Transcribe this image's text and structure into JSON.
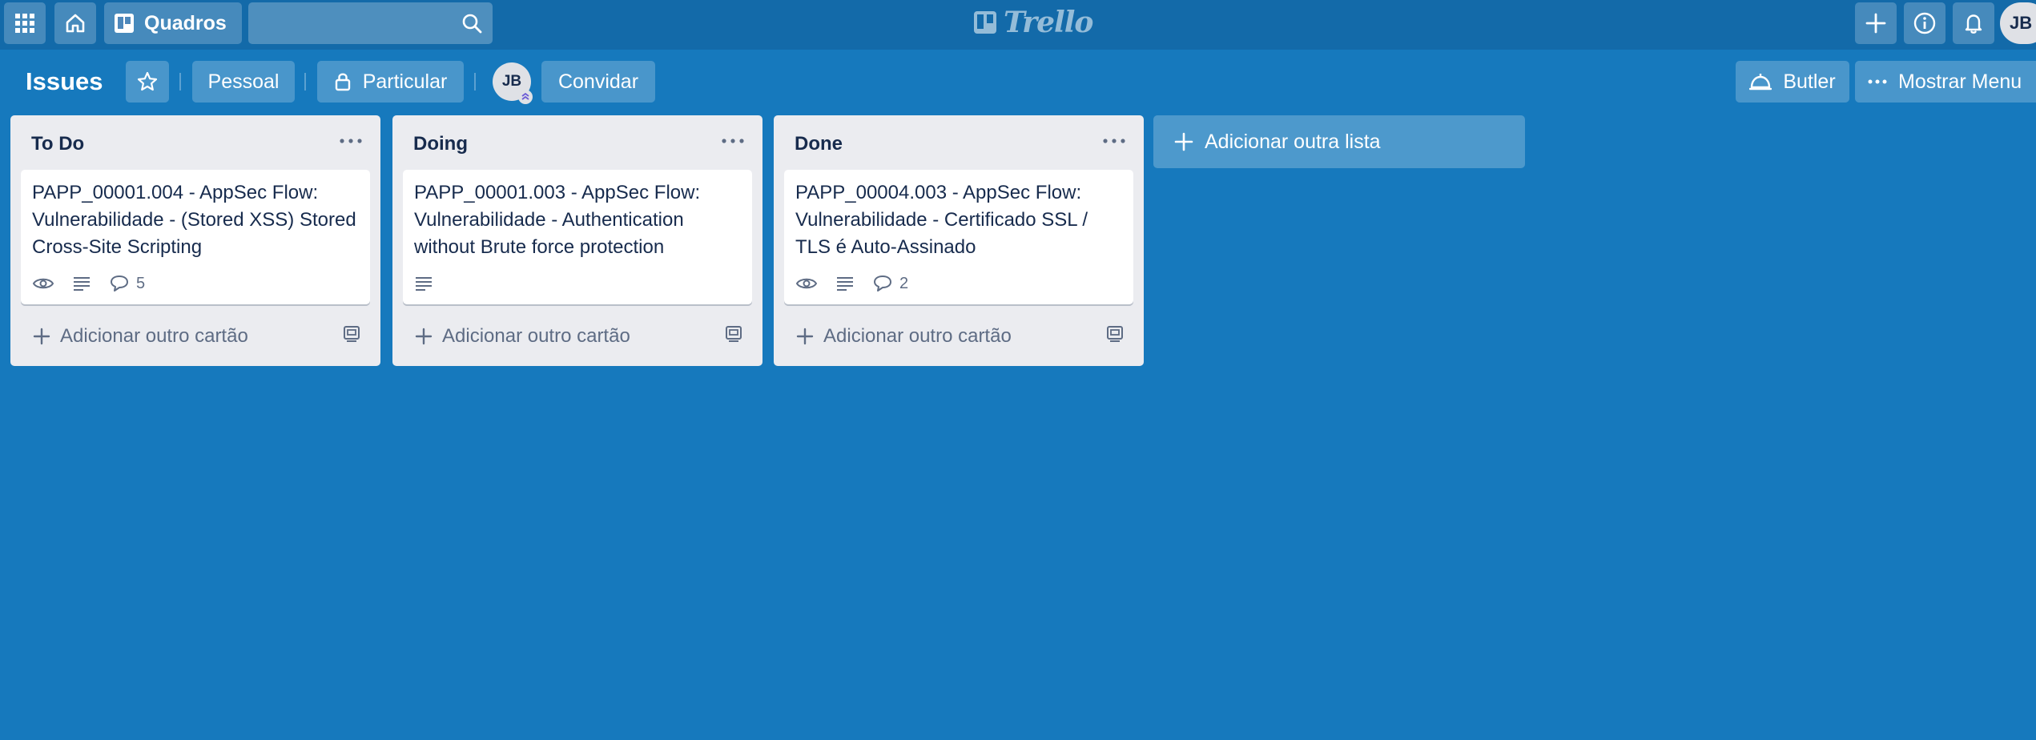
{
  "topbar": {
    "boards_label": "Quadros",
    "search_value": "",
    "logo_text": "Trello",
    "avatar_initials": "JB"
  },
  "board": {
    "title": "Issues",
    "visibility_team": "Pessoal",
    "visibility_private": "Particular",
    "member_initials": "JB",
    "invite_label": "Convidar",
    "butler_label": "Butler",
    "menu_label": "Mostrar Menu"
  },
  "lists": [
    {
      "title": "To Do",
      "card": {
        "title": "PAPP_00001.004 - AppSec Flow: Vulnerabilidade - (Stored XSS) Stored Cross-Site Scripting",
        "watching": true,
        "has_description": true,
        "comments": "5"
      },
      "add_card_label": "Adicionar outro cartão"
    },
    {
      "title": "Doing",
      "card": {
        "title": "PAPP_00001.003 - AppSec Flow: Vulnerabilidade - Authentication without Brute force protection",
        "watching": false,
        "has_description": true,
        "comments": ""
      },
      "add_card_label": "Adicionar outro cartão"
    },
    {
      "title": "Done",
      "card": {
        "title": "PAPP_00004.003 - AppSec Flow: Vulnerabilidade - Certificado SSL / TLS é Auto-Assinado",
        "watching": true,
        "has_description": true,
        "comments": "2"
      },
      "add_card_label": "Adicionar outro cartão"
    }
  ],
  "add_list_label": "Adicionar outra lista",
  "colors": {
    "board_background": "#1679bd",
    "topbar_background": "#136aa9",
    "list_background": "#ebecf0",
    "card_background": "#ffffff"
  }
}
